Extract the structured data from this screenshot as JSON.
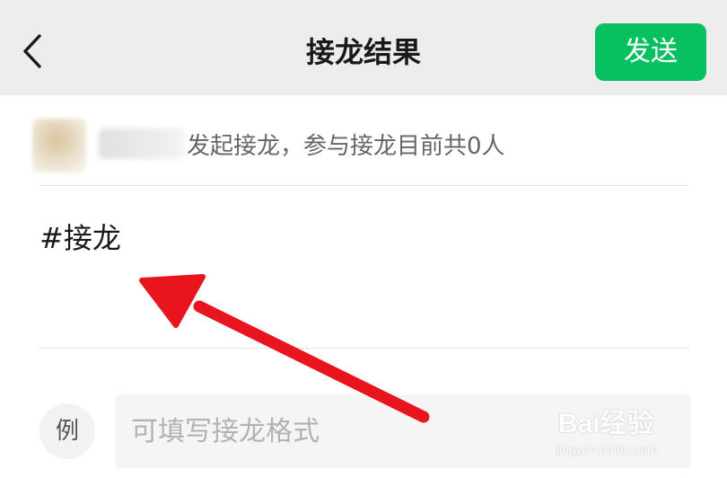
{
  "header": {
    "title": "接龙结果",
    "send_label": "发送",
    "back_icon": "chevron-left-icon",
    "accent_color": "#07c160",
    "background_color": "#ededed"
  },
  "info": {
    "description": "发起接龙，参与接龙目前共0人"
  },
  "content": {
    "text": "#接龙"
  },
  "example": {
    "badge_label": "例",
    "placeholder": "可填写接龙格式"
  },
  "annotation": {
    "arrow_color": "#e8151e"
  },
  "watermark": {
    "brand": "Bai经验",
    "url": "jingyan.baidu.com"
  }
}
